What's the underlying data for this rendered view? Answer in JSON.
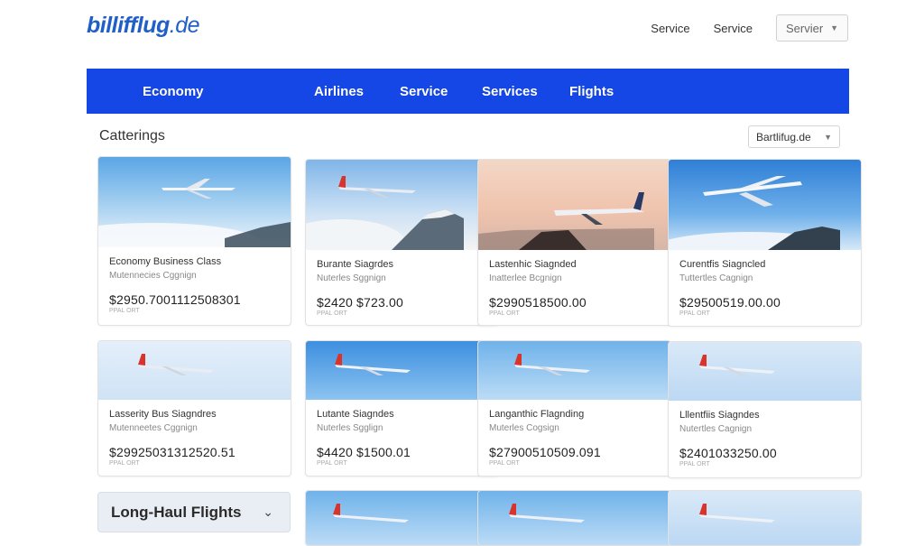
{
  "brand": {
    "name": "billifflug",
    "tld": ".de"
  },
  "top_nav": {
    "link1": "Service",
    "link2": "Service",
    "select_value": "Servier"
  },
  "main_nav": {
    "items": [
      "Economy",
      "Airlines",
      "Service",
      "Services",
      "Flights"
    ]
  },
  "section": {
    "title": "Catterings",
    "filter_value": "Bartlifug.de"
  },
  "cards": [
    {
      "title": "Economy Business Class",
      "sub": "Mutennecies Cggnign",
      "price": "$2950.7001112508301",
      "note": "PPAL ORT"
    },
    {
      "title": "Burante Siagrdes",
      "sub": "Nuterles Sggnign",
      "price": "$2420 $723.00",
      "note": "PPAL ORT"
    },
    {
      "title": "Lastenhic Siagnded",
      "sub": "Inatterlee Bcgnign",
      "price": "$2990518500.00",
      "note": "PPAL ORT"
    },
    {
      "title": "Curentfis Siagncled",
      "sub": "Tuttertles Cagnign",
      "price": "$29500519.00.00",
      "note": "PPAL ORT"
    },
    {
      "title": "Lasserity Bus Siagndres",
      "sub": "Mutenneetes Cggnign",
      "price": "$29925031312520.51",
      "note": "PPAL ORT"
    },
    {
      "title": "Lutante Siagndes",
      "sub": "Nuterles Sgglign",
      "price": "$4420 $1500.01",
      "note": "PPAL ORT"
    },
    {
      "title": "Langanthic Flagnding",
      "sub": "Muterles Cogsign",
      "price": "$27900510509.091",
      "note": "PPAL ORT"
    },
    {
      "title": "Lllentfiis Siagndes",
      "sub": "Nutertles Cagnign",
      "price": "$2401033250.00",
      "note": "PPAL ORT"
    }
  ],
  "accordion": {
    "label": "Long-Haul Flights"
  },
  "colors": {
    "brand_blue": "#1f5fc7",
    "navbar_blue": "#1447e6"
  },
  "icons": {
    "dropdown": "chevron-down-icon",
    "plane": "airplane-icon"
  }
}
